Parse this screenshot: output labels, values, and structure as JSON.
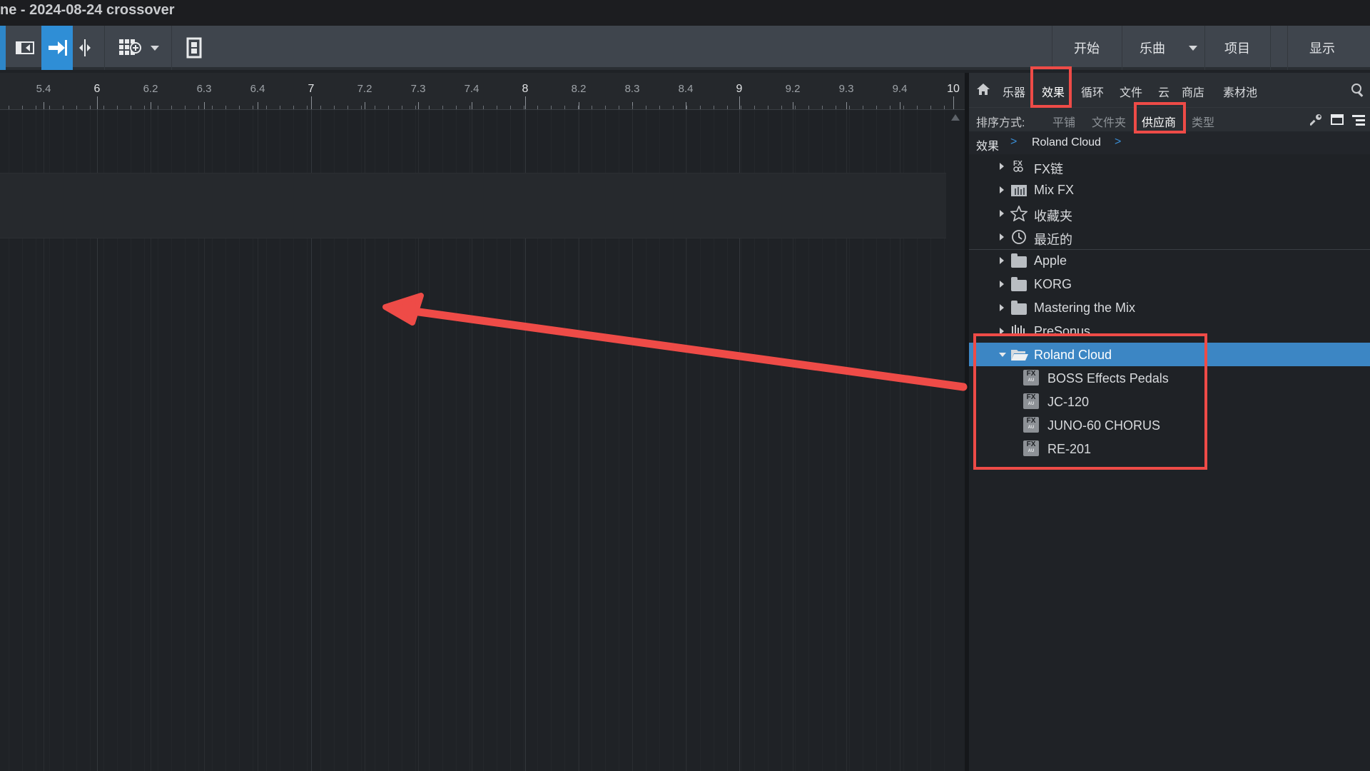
{
  "window": {
    "title": "ne - 2024-08-24 crossover"
  },
  "toolbar": {
    "start_label": "开始",
    "song_label": "乐曲",
    "project_label": "项目",
    "show_label": "显示"
  },
  "ruler": {
    "labels": [
      "5.4",
      "6",
      "6.2",
      "6.3",
      "6.4",
      "7",
      "7.2",
      "7.3",
      "7.4",
      "8",
      "8.2",
      "8.3",
      "8.4",
      "9",
      "9.2",
      "9.3",
      "9.4",
      "10"
    ]
  },
  "browser": {
    "tabs": {
      "instruments": "乐器",
      "effects": "效果",
      "loops": "循环",
      "files": "文件",
      "cloud": "云",
      "shop": "商店",
      "pool": "素材池"
    },
    "sort": {
      "label": "排序方式:",
      "flat": "平铺",
      "folder": "文件夹",
      "vendor": "供应商",
      "type": "类型"
    },
    "breadcrumb": {
      "root": "效果",
      "current": "Roland Cloud"
    },
    "items": [
      {
        "label": "FX链"
      },
      {
        "label": "Mix FX"
      },
      {
        "label": "收藏夹"
      },
      {
        "label": "最近的"
      },
      {
        "label": "Apple"
      },
      {
        "label": "KORG"
      },
      {
        "label": "Mastering the Mix"
      },
      {
        "label": "PreSonus"
      },
      {
        "label": "Roland Cloud"
      }
    ],
    "plugins": [
      {
        "label": "BOSS Effects Pedals",
        "badge": "FX",
        "sub": "AU"
      },
      {
        "label": "JC-120",
        "badge": "FX",
        "sub": "AU"
      },
      {
        "label": "JUNO-60 CHORUS",
        "badge": "FX",
        "sub": "AU"
      },
      {
        "label": "RE-201",
        "badge": "FX",
        "sub": "AU"
      }
    ]
  },
  "colors": {
    "accent": "#2f8ed6",
    "selection": "#3c86c4",
    "annotation": "#ee4b47"
  }
}
